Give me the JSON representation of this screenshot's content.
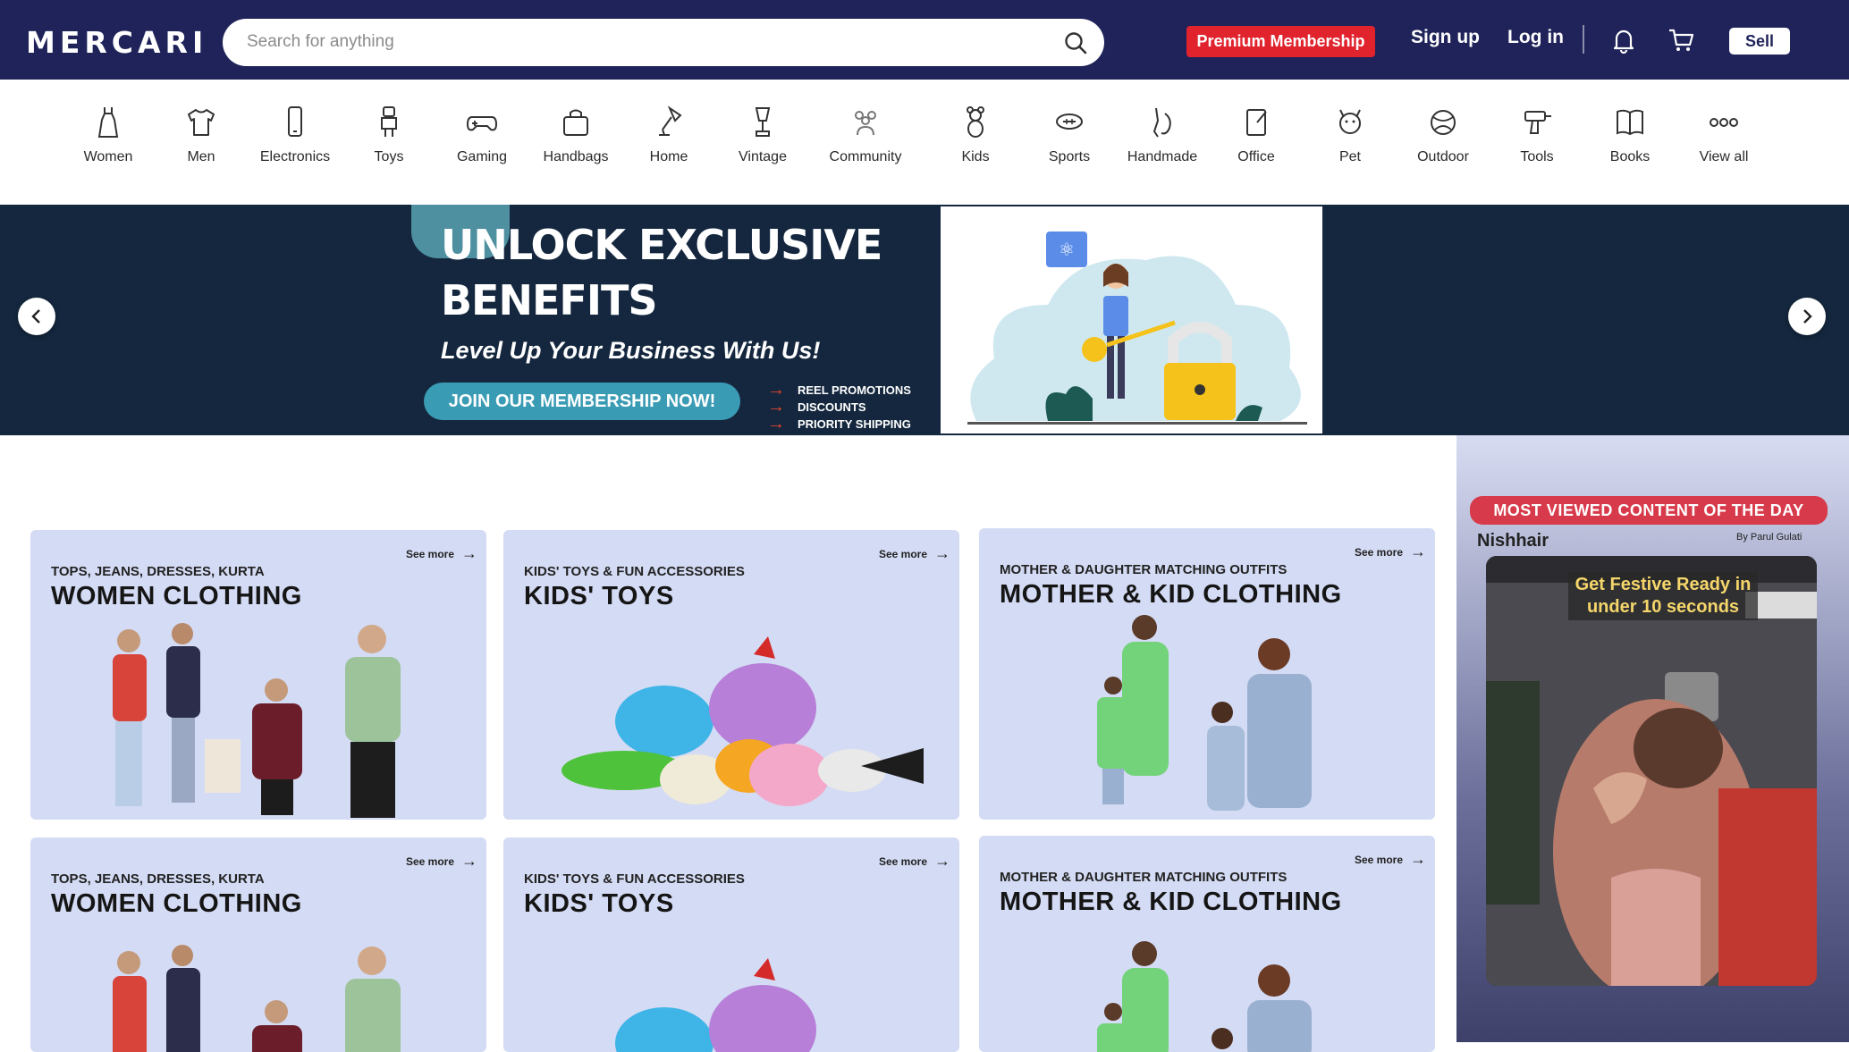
{
  "header": {
    "logo": "MERCARI",
    "search_placeholder": "Search for anything",
    "premium_label": "Premium Membership",
    "signup_label": "Sign up",
    "login_label": "Log in",
    "sell_label": "Sell"
  },
  "categories": [
    {
      "label": "Women",
      "icon": "dress-icon"
    },
    {
      "label": "Men",
      "icon": "tshirt-icon"
    },
    {
      "label": "Electronics",
      "icon": "phone-icon"
    },
    {
      "label": "Toys",
      "icon": "robot-toy-icon"
    },
    {
      "label": "Gaming",
      "icon": "gamepad-icon"
    },
    {
      "label": "Handbags",
      "icon": "handbag-icon"
    },
    {
      "label": "Home",
      "icon": "lamp-icon"
    },
    {
      "label": "Vintage",
      "icon": "gramophone-icon"
    },
    {
      "label": "Community",
      "icon": "people-icon"
    },
    {
      "label": "Kids",
      "icon": "teddy-icon"
    },
    {
      "label": "Sports",
      "icon": "football-icon"
    },
    {
      "label": "Handmade",
      "icon": "hands-icon"
    },
    {
      "label": "Office",
      "icon": "notepad-icon"
    },
    {
      "label": "Pet",
      "icon": "cat-icon"
    },
    {
      "label": "Outdoor",
      "icon": "ball-icon"
    },
    {
      "label": "Tools",
      "icon": "drill-icon"
    },
    {
      "label": "Books",
      "icon": "book-icon"
    },
    {
      "label": "View all",
      "icon": "more-dots-icon"
    }
  ],
  "banner": {
    "headline_line1": "UNLOCK EXCLUSIVE",
    "headline_line2": "BENEFITS",
    "subtitle": "Level Up Your Business With Us!",
    "cta": "JOIN OUR MEMBERSHIP NOW!",
    "perks": [
      "REEL PROMOTIONS",
      "DISCOUNTS",
      "PRIORITY SHIPPING"
    ]
  },
  "cards": [
    {
      "sub": "TOPS, JEANS, DRESSES, KURTA",
      "title": "WOMEN CLOTHING",
      "see_more": "See more"
    },
    {
      "sub": "KIDS' TOYS & FUN ACCESSORIES",
      "title": "KIDS' TOYS",
      "see_more": "See more"
    },
    {
      "sub": "MOTHER & DAUGHTER MATCHING OUTFITS",
      "title": "MOTHER & KID CLOTHING",
      "see_more": "See more"
    },
    {
      "sub": "TOPS, JEANS, DRESSES, KURTA",
      "title": "WOMEN CLOTHING",
      "see_more": "See more"
    },
    {
      "sub": "KIDS' TOYS & FUN ACCESSORIES",
      "title": "KIDS' TOYS",
      "see_more": "See more"
    },
    {
      "sub": "MOTHER & DAUGHTER MATCHING OUTFITS",
      "title": "MOTHER & KID CLOTHING",
      "see_more": "See more"
    }
  ],
  "side": {
    "badge": "MOST VIEWED CONTENT OF THE DAY",
    "name": "Nishhair",
    "by": "By Parul Gulati",
    "caption": "Get Festive Ready in under 10 seconds"
  },
  "colors": {
    "header_bg": "#1f2359",
    "premium": "#e0232d",
    "banner_bg": "#14273e",
    "card_bg": "#d4dbf4",
    "badge": "#d73a4a"
  }
}
